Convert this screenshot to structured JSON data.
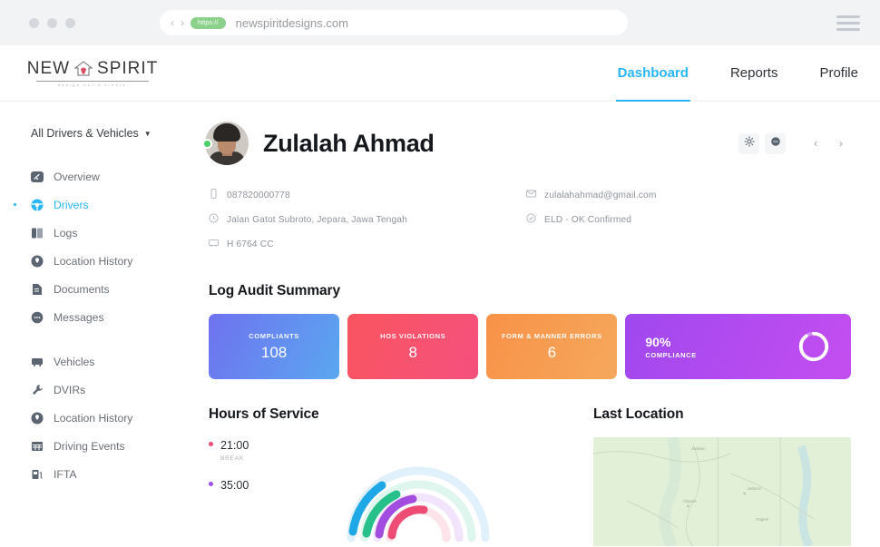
{
  "browser": {
    "back_label": "‹",
    "forward_label": "›",
    "protocol_badge": "https://",
    "url": "newspiritdesigns.com"
  },
  "header": {
    "logo": {
      "word_left": "NEW",
      "word_right": "SPIRIT",
      "tagline": "design    build    create"
    },
    "nav": [
      {
        "label": "Dashboard",
        "active": true
      },
      {
        "label": "Reports",
        "active": false
      },
      {
        "label": "Profile",
        "active": false
      }
    ],
    "accent_color": "#29b6f6"
  },
  "sidebar": {
    "selector_label": "All Drivers & Vehicles",
    "group_one": [
      {
        "label": "Overview",
        "icon": "gauge-icon",
        "active": false
      },
      {
        "label": "Drivers",
        "icon": "steering-wheel-icon",
        "active": true
      },
      {
        "label": "Logs",
        "icon": "book-icon",
        "active": false
      },
      {
        "label": "Location History",
        "icon": "map-pin-icon",
        "active": false
      },
      {
        "label": "Documents",
        "icon": "document-icon",
        "active": false
      },
      {
        "label": "Messages",
        "icon": "chat-bubble-icon",
        "active": false
      }
    ],
    "group_two": [
      {
        "label": "Vehicles",
        "icon": "truck-icon",
        "active": false
      },
      {
        "label": "DVIRs",
        "icon": "wrench-icon",
        "active": false
      },
      {
        "label": "Location History",
        "icon": "map-pin-icon",
        "active": false
      },
      {
        "label": "Driving Events",
        "icon": "calendar-icon",
        "active": false
      },
      {
        "label": "IFTA",
        "icon": "fuel-pump-icon",
        "active": false
      }
    ]
  },
  "profile": {
    "name": "Zulalah Ahmad",
    "status": "online",
    "meta": [
      {
        "icon": "phone-icon",
        "value": "087820000778"
      },
      {
        "icon": "mail-icon",
        "value": "zulalahahmad@gmail.com"
      },
      {
        "icon": "clock-icon",
        "value": "Jalan Gatot Subroto, Jepara, Jawa Tengah"
      },
      {
        "icon": "check-circle-icon",
        "value": "ELD - OK Confirmed"
      },
      {
        "icon": "truck-icon",
        "value": "H 6764 CC"
      }
    ],
    "actions": {
      "settings": "gear-icon",
      "message": "chat-bubble-icon",
      "prev": "‹",
      "next": "›"
    }
  },
  "audit": {
    "title": "Log Audit Summary",
    "cards": [
      {
        "label": "COMPLIANTS",
        "value": "108",
        "color_start": "#6f72ef",
        "color_end": "#5aa7f0"
      },
      {
        "label": "HOS VIOLATIONS",
        "value": "8",
        "color_start": "#f9555f",
        "color_end": "#f5507e"
      },
      {
        "label": "FORM & MANNER ERRORS",
        "value": "6",
        "color_start": "#f79248",
        "color_end": "#f6a85c"
      }
    ],
    "compliance": {
      "percent": "90%",
      "label": "COMPLIANCE",
      "value": 90,
      "color_start": "#a048ef",
      "color_end": "#c44ef0"
    }
  },
  "hours_of_service": {
    "title": "Hours of Service",
    "entries": [
      {
        "time": "21:00",
        "label": "BREAK",
        "color": "#ee4c74"
      },
      {
        "time": "35:00",
        "label": "",
        "color": "#9b4df0"
      }
    ],
    "arc_colors": [
      "#1fa8e8",
      "#27c08a",
      "#a34ce0",
      "#ee4c74"
    ]
  },
  "last_location": {
    "title": "Last Location",
    "map_labels": [
      "Jackson",
      "Clopers",
      "Rogers"
    ]
  }
}
